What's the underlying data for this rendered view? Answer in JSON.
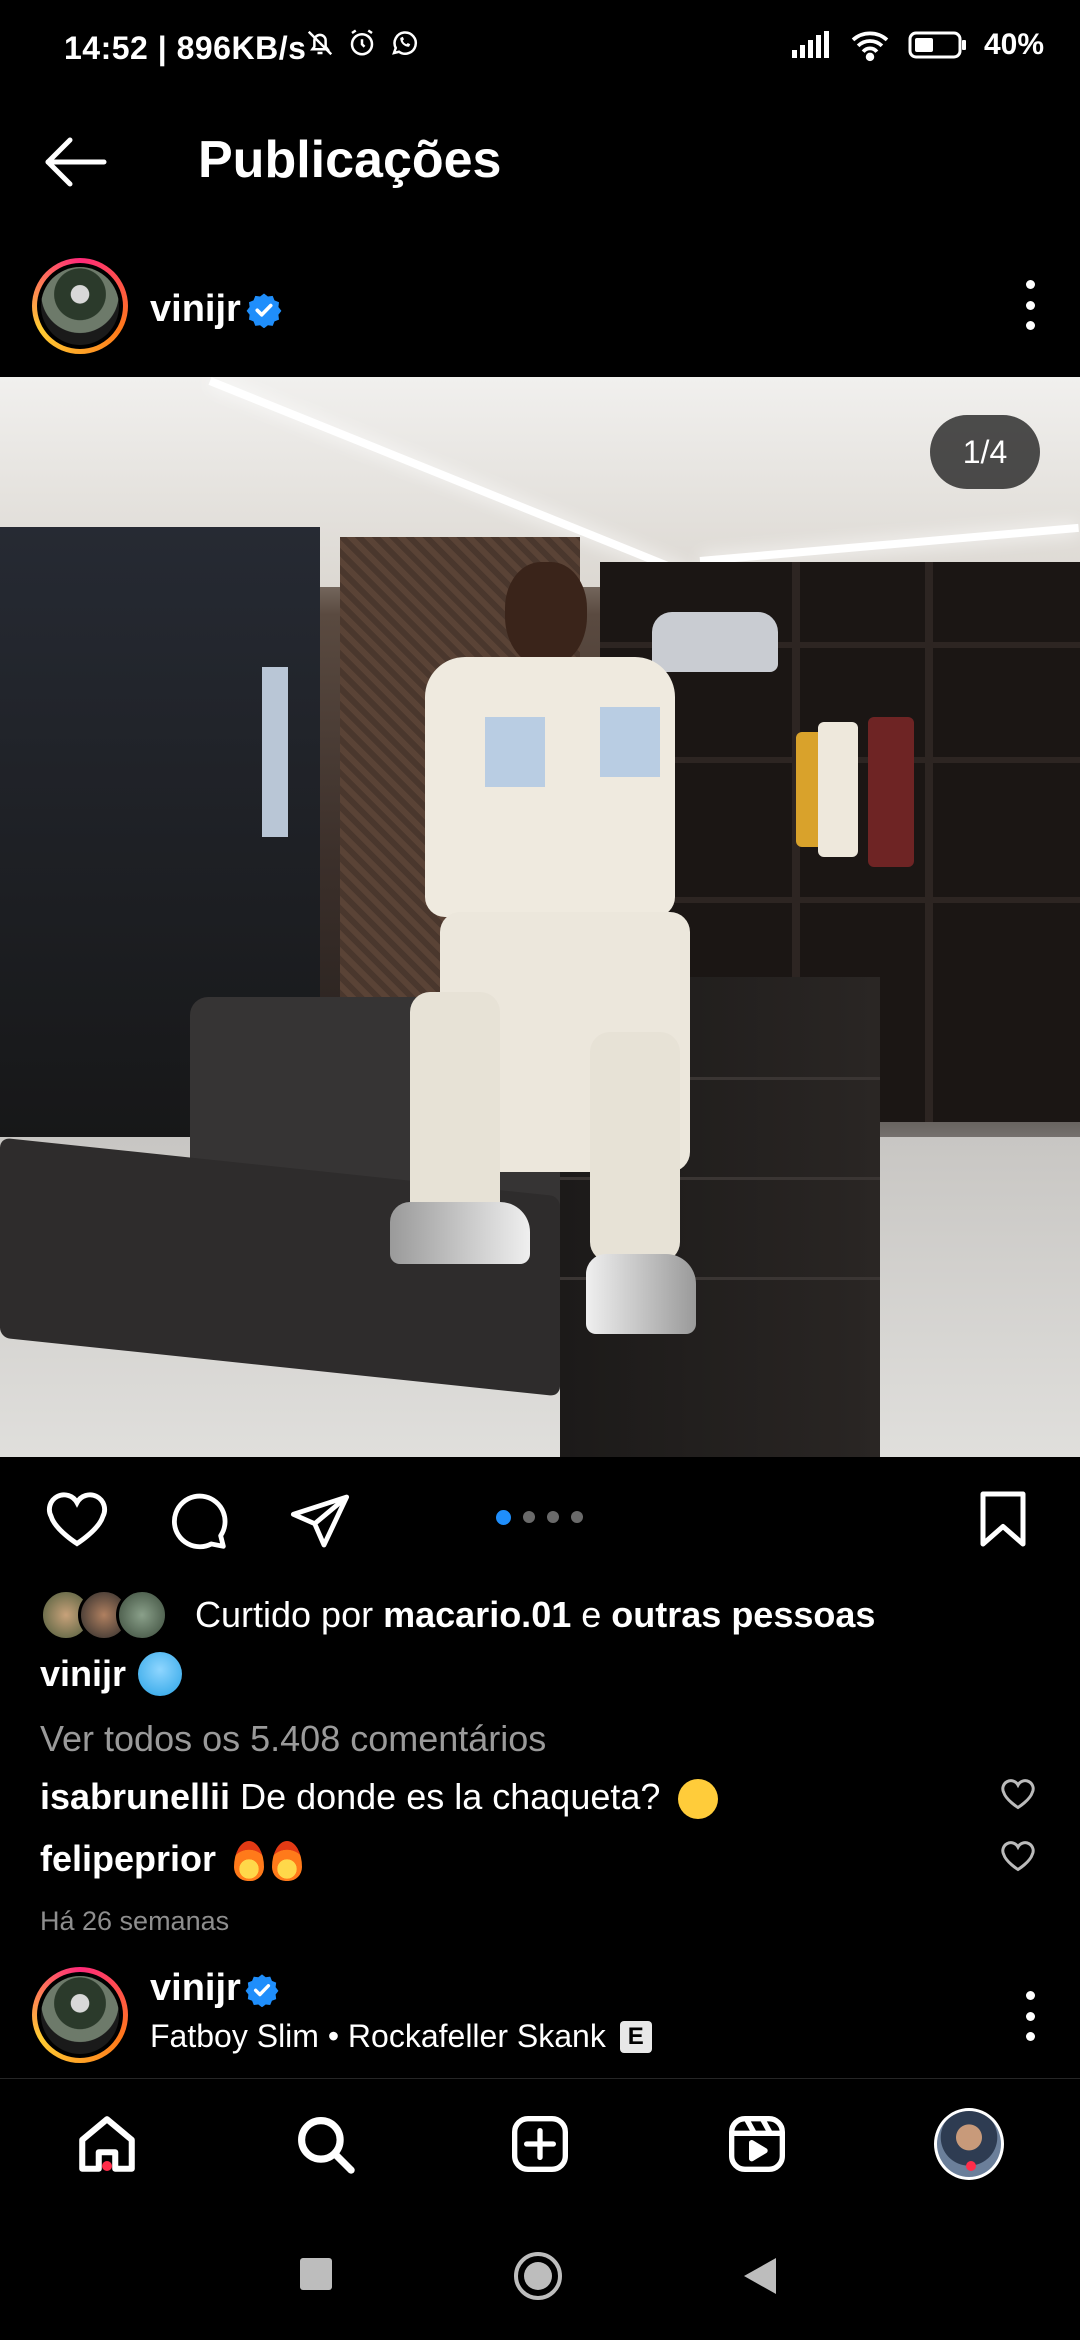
{
  "status_bar": {
    "time": "14:52 | 896KB/s",
    "battery": "40%"
  },
  "header": {
    "title": "Publicações"
  },
  "post": {
    "username": "vinijr",
    "image_counter": "1/4",
    "carousel": {
      "total": 4,
      "active": 1
    },
    "likes_prefix": "Curtido por",
    "likes_user": "macario.01",
    "likes_connector": "e",
    "likes_others": "outras pessoas",
    "caption_user": "vinijr",
    "view_comments": "Ver todos os 5.408 comentários",
    "comments": [
      {
        "user": "isabrunellii",
        "text": "De donde es la chaqueta?"
      },
      {
        "user": "felipeprior",
        "text": ""
      }
    ],
    "time_ago": "Há 26 semanas"
  },
  "next_post": {
    "username": "vinijr",
    "music": "Fatboy Slim • Rockafeller Skank",
    "explicit": "E"
  },
  "colors": {
    "background": "#000000",
    "accent_blue": "#1f8efb",
    "notification_red": "#ff2d4a",
    "muted_text": "#9a9a9a"
  },
  "icons": {
    "nav": [
      "home-icon",
      "search-icon",
      "create-icon",
      "reels-icon",
      "profile-avatar"
    ],
    "actions": [
      "heart-icon",
      "comment-icon",
      "share-icon",
      "bookmark-icon"
    ]
  }
}
